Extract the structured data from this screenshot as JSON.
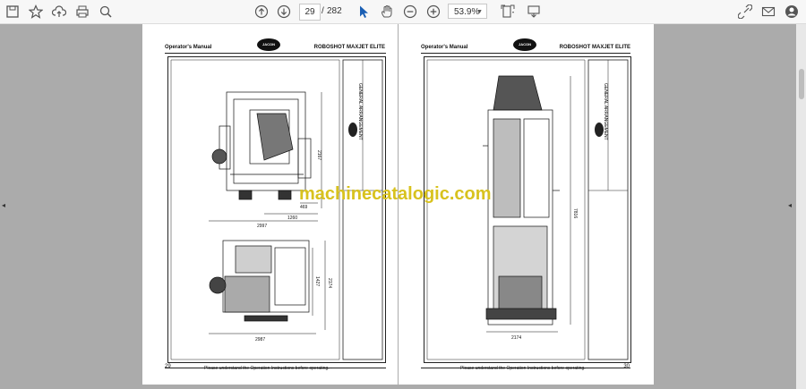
{
  "toolbar": {
    "page_current": "29",
    "page_separator": "/",
    "page_total": "282",
    "zoom": "53.9%",
    "icons": [
      "save-icon",
      "bookmark-star-icon",
      "upload-icon",
      "print-icon",
      "zoom-search-icon",
      "page-up-icon",
      "page-down-icon",
      "select-cursor-icon",
      "hand-icon",
      "zoom-out-icon",
      "zoom-in-icon",
      "fit-page-icon",
      "annotate-icon",
      "link-icon",
      "mail-icon",
      "account-icon"
    ]
  },
  "pages": [
    {
      "header_left": "Operator's Manual",
      "logo": "JACON",
      "header_right": "ROBOSHOT MAXJET ELITE",
      "footer_note": "- Please understand the Operation Instructions before operating. -",
      "page_number": "29",
      "dimensions": [
        "2997",
        "1260",
        "2167",
        "469",
        "2987",
        "2174",
        "1427"
      ]
    },
    {
      "header_left": "Operator's Manual",
      "logo": "JACON",
      "header_right": "ROBOSHOT MAXJET ELITE",
      "footer_note": "- Please understand the Operation Instructions before operating. -",
      "page_number": "30",
      "dimensions": [
        "7816",
        "2174"
      ]
    }
  ],
  "watermark": "machinecatalogic.com"
}
